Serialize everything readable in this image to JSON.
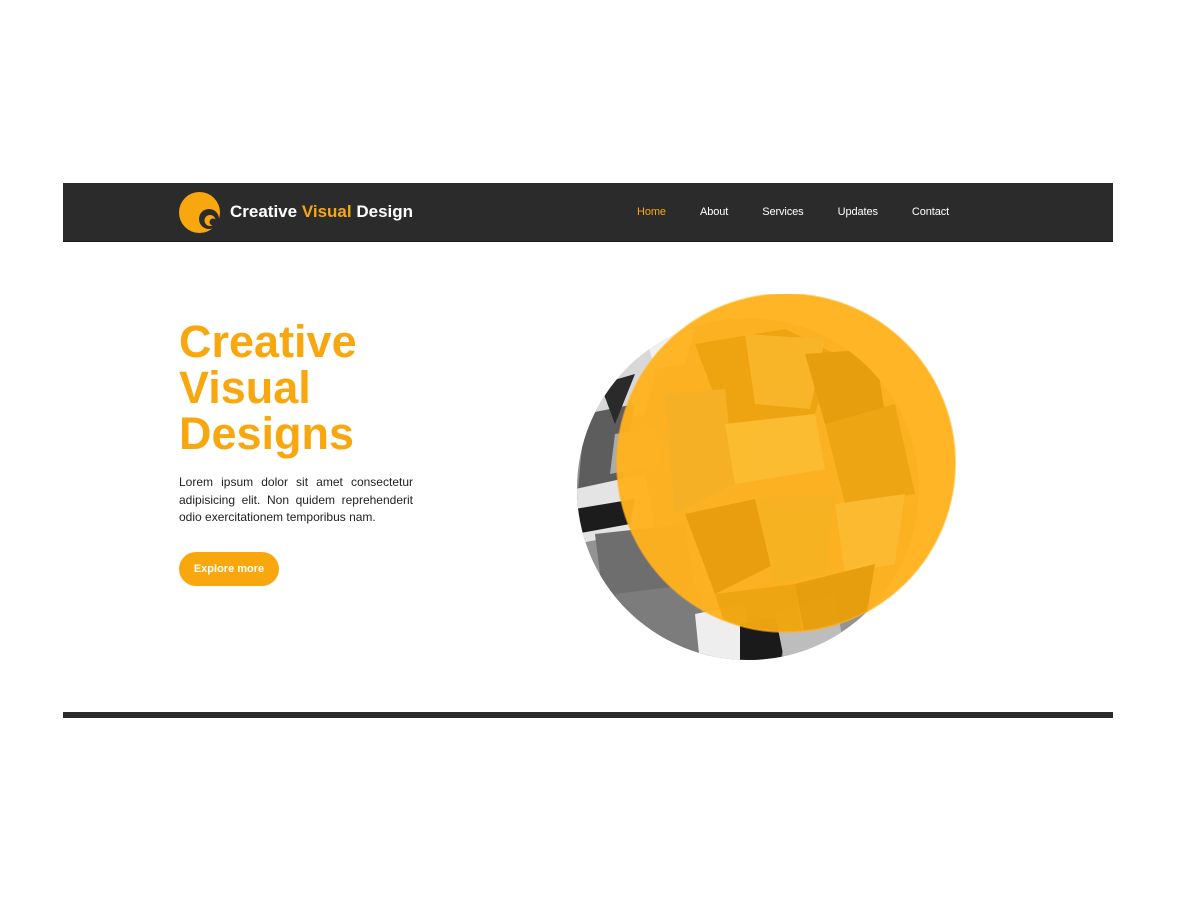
{
  "brand": {
    "name_part1": "Creative ",
    "name_accent": "Visual",
    "name_part2": " Design",
    "logo_icon": "crescent-logo-icon",
    "accent_color": "#f8a80e",
    "dark_color": "#2b2b2b"
  },
  "nav": {
    "items": [
      {
        "label": "Home",
        "active": true
      },
      {
        "label": "About",
        "active": false
      },
      {
        "label": "Services",
        "active": false
      },
      {
        "label": "Updates",
        "active": false
      },
      {
        "label": "Contact",
        "active": false
      }
    ]
  },
  "hero": {
    "title_lines": [
      "Creative",
      "Visual",
      "Designs"
    ],
    "text": "Lorem ipsum dolor sit amet consectetur adipisicing elit. Non quidem reprehenderit odio exercitationem temporibus nam.",
    "cta_label": "Explore more",
    "image": "abstract-graffiti-photo-with-yellow-circle-overlay"
  }
}
